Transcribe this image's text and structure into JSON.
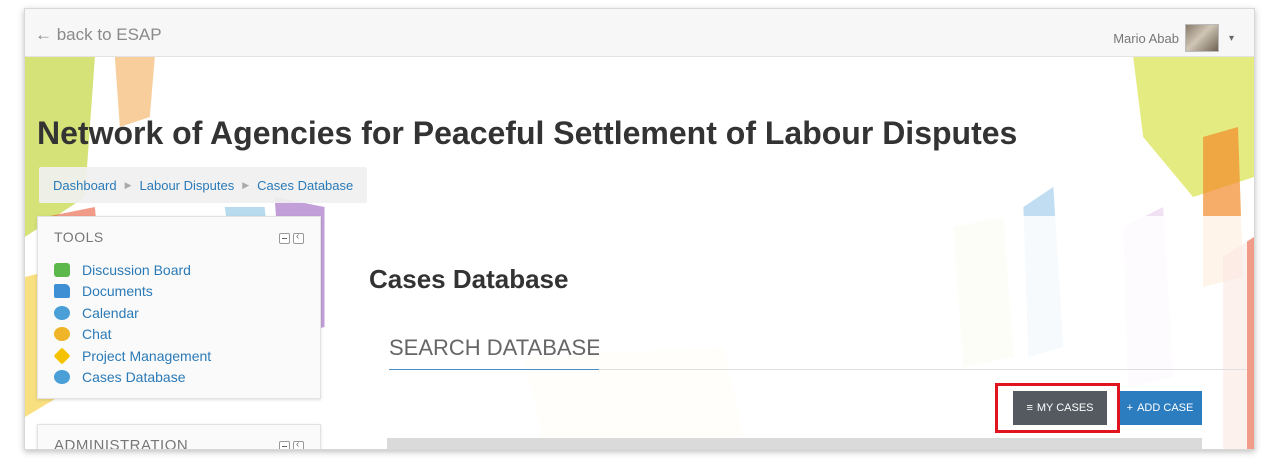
{
  "topbar": {
    "back_link": "← back to ESAP",
    "user_name": "Mario Abab",
    "caret": "▾"
  },
  "site_title": "Network of Agencies for Peaceful Settlement of Labour Disputes",
  "breadcrumb": {
    "items": [
      "Dashboard",
      "Labour Disputes",
      "Cases Database"
    ],
    "separator": "▶"
  },
  "tools_block": {
    "title": "TOOLS",
    "items": [
      {
        "label": "Discussion Board",
        "icon": "discussion-icon"
      },
      {
        "label": "Documents",
        "icon": "folder-icon"
      },
      {
        "label": "Calendar",
        "icon": "calendar-icon"
      },
      {
        "label": "Chat",
        "icon": "chat-icon"
      },
      {
        "label": "Project Management",
        "icon": "project-icon"
      },
      {
        "label": "Cases Database",
        "icon": "database-icon"
      }
    ]
  },
  "admin_block": {
    "title": "ADMINISTRATION"
  },
  "main": {
    "heading": "Cases Database",
    "search_placeholder": "SEARCH DATABASE",
    "my_cases_label": "MY CASES",
    "my_cases_icon": "≡",
    "add_case_label": "ADD CASE",
    "add_case_icon": "+"
  },
  "colors": {
    "link": "#2a7ab8",
    "primary_button": "#2b7dc0",
    "dark_button": "#555a61",
    "highlight": "#e0141f"
  }
}
